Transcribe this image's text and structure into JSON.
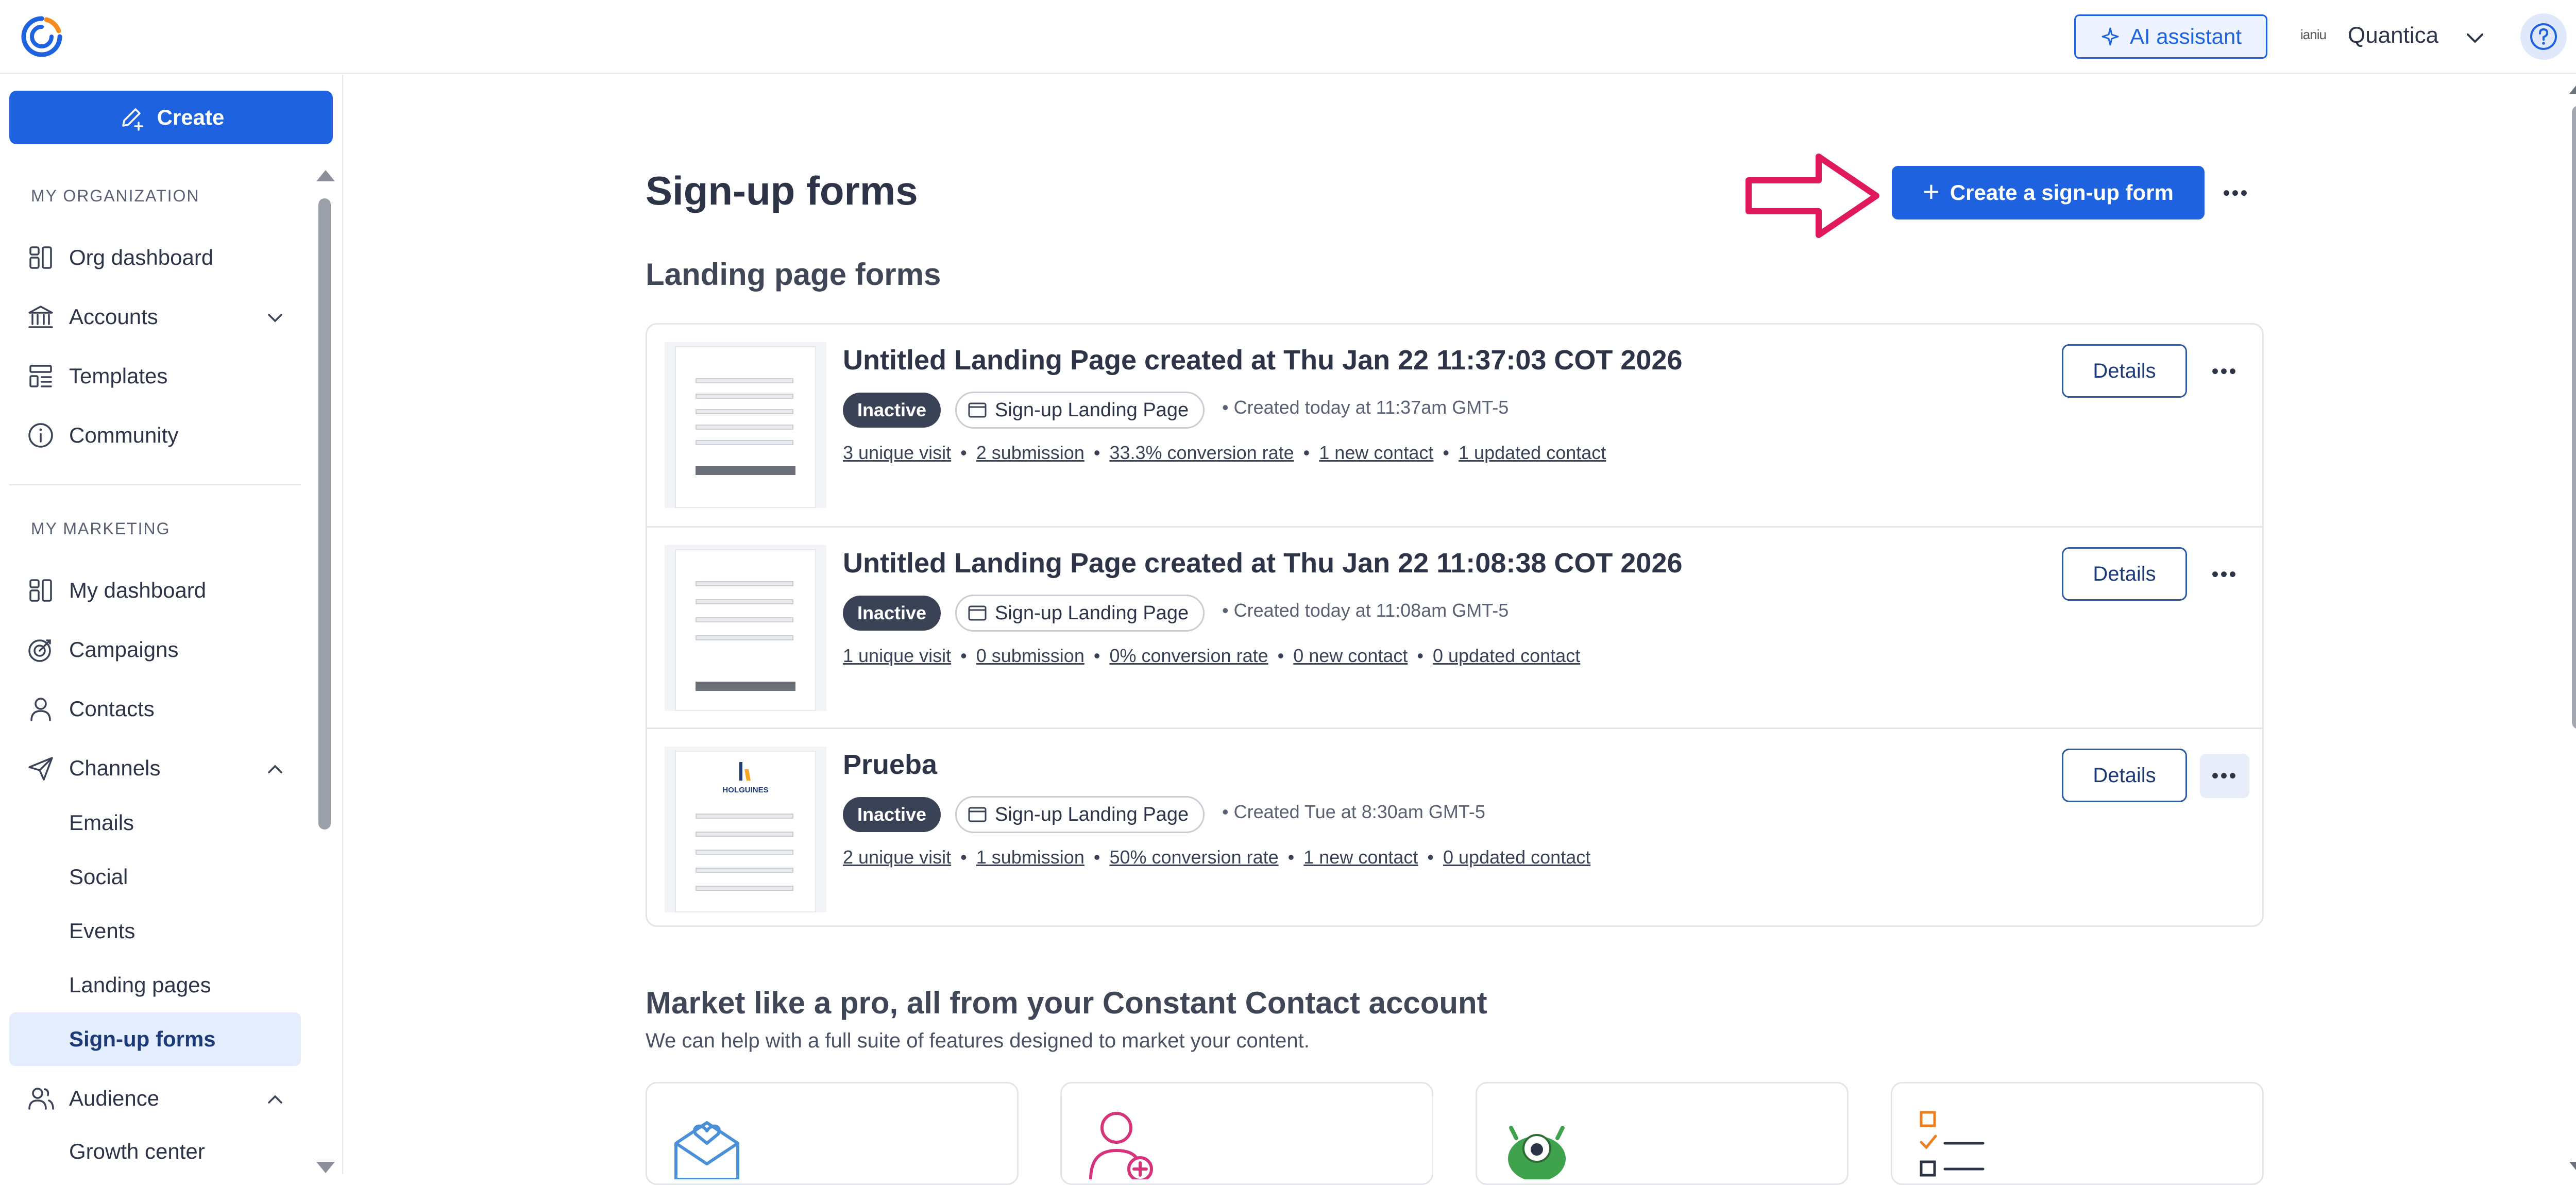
{
  "topbar": {
    "ai_assistant_label": "AI assistant",
    "account_logo_text": "ianiu",
    "account_name": "Quantica"
  },
  "sidebar": {
    "create_label": "Create",
    "org_section": "MY ORGANIZATION",
    "org_items": [
      {
        "label": "Org dashboard",
        "icon": "dashboard-icon"
      },
      {
        "label": "Accounts",
        "icon": "bank-icon"
      },
      {
        "label": "Templates",
        "icon": "templates-icon"
      },
      {
        "label": "Community",
        "icon": "info-icon"
      }
    ],
    "marketing_section": "MY MARKETING",
    "marketing_items": [
      {
        "label": "My dashboard",
        "icon": "dashboard-icon"
      },
      {
        "label": "Campaigns",
        "icon": "target-icon"
      },
      {
        "label": "Contacts",
        "icon": "person-icon"
      },
      {
        "label": "Channels",
        "icon": "send-icon"
      }
    ],
    "channel_subitems": [
      "Emails",
      "Social",
      "Events",
      "Landing pages",
      "Sign-up forms"
    ],
    "active_item": "Sign-up forms",
    "audience_label": "Audience",
    "audience_subitems": [
      "Growth center"
    ]
  },
  "main": {
    "page_title": "Sign-up forms",
    "create_form_label": "Create a sign-up form",
    "section_title": "Landing page forms",
    "forms": [
      {
        "title": "Untitled Landing Page created at Thu Jan 22 11:37:03 COT 2026",
        "status": "Inactive",
        "type": "Sign-up Landing Page",
        "created": "Created today at 11:37am GMT-5",
        "stats": [
          "3 unique visit",
          "2 submission",
          "33.3% conversion rate",
          "1 new contact",
          "1 updated contact"
        ],
        "details_label": "Details"
      },
      {
        "title": "Untitled Landing Page created at Thu Jan 22 11:08:38 COT 2026",
        "status": "Inactive",
        "type": "Sign-up Landing Page",
        "created": "Created today at 11:08am GMT-5",
        "stats": [
          "1 unique visit",
          "0 submission",
          "0% conversion rate",
          "0 new contact",
          "0 updated contact"
        ],
        "details_label": "Details"
      },
      {
        "title": "Prueba",
        "status": "Inactive",
        "type": "Sign-up Landing Page",
        "created": "Created Tue at 8:30am GMT-5",
        "stats": [
          "2 unique visit",
          "1 submission",
          "50% conversion rate",
          "1 new contact",
          "0 updated contact"
        ],
        "details_label": "Details"
      }
    ],
    "thumb_text": "HOLGUINES",
    "promo_title": "Market like a pro, all from your Constant Contact account",
    "promo_subtitle": "We can help with a full suite of features designed to market your content."
  },
  "colors": {
    "primary": "#1f62e0",
    "annotation_arrow": "#e0195a",
    "badge_inactive": "#3a4256",
    "active_nav_bg": "#e4edfb"
  }
}
